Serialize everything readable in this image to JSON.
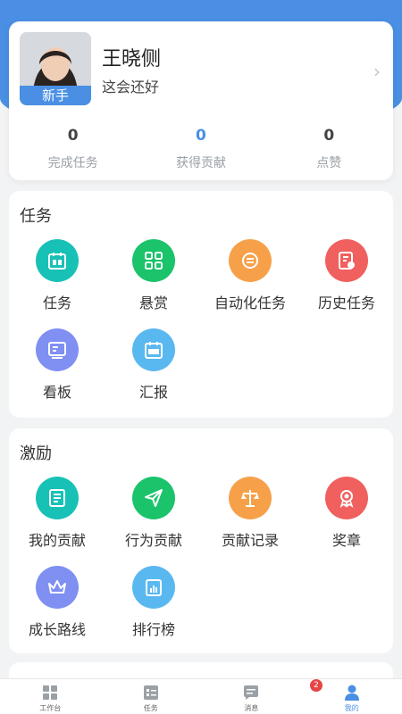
{
  "profile": {
    "name": "王晓侧",
    "subtitle": "这会还好",
    "badge": "新手",
    "stats": [
      {
        "value": "0",
        "label": "完成任务"
      },
      {
        "value": "0",
        "label": "获得贡献"
      },
      {
        "value": "0",
        "label": "点赞"
      }
    ]
  },
  "sections": [
    {
      "title": "任务",
      "items": [
        {
          "label": "任务",
          "icon": "calendar-icon",
          "color": "#17c1b6"
        },
        {
          "label": "悬赏",
          "icon": "grid-apps-icon",
          "color": "#1bc36b"
        },
        {
          "label": "自动化任务",
          "icon": "automation-icon",
          "color": "#f6a14a"
        },
        {
          "label": "历史任务",
          "icon": "history-doc-icon",
          "color": "#f0605e"
        },
        {
          "label": "看板",
          "icon": "kanban-icon",
          "color": "#7f8ff2"
        },
        {
          "label": "汇报",
          "icon": "report-day-icon",
          "color": "#5ab8f0"
        }
      ]
    },
    {
      "title": "激励",
      "items": [
        {
          "label": "我的贡献",
          "icon": "my-contribution-icon",
          "color": "#17c1b6"
        },
        {
          "label": "行为贡献",
          "icon": "paper-plane-icon",
          "color": "#1bc36b"
        },
        {
          "label": "贡献记录",
          "icon": "scale-icon",
          "color": "#f6a14a"
        },
        {
          "label": "奖章",
          "icon": "medal-icon",
          "color": "#f0605e"
        },
        {
          "label": "成长路线",
          "icon": "crown-icon",
          "color": "#7f8ff2"
        },
        {
          "label": "排行榜",
          "icon": "leaderboard-icon",
          "color": "#5ab8f0"
        }
      ]
    }
  ],
  "tabbar": {
    "items": [
      {
        "label": "工作台",
        "icon": "workbench-icon"
      },
      {
        "label": "任务",
        "icon": "task-list-icon"
      },
      {
        "label": "消息",
        "icon": "message-icon",
        "badge": "2"
      },
      {
        "label": "我的",
        "icon": "user-icon"
      }
    ]
  },
  "colors": {
    "accent": "#4a8fe3",
    "badge": "#e64545"
  }
}
